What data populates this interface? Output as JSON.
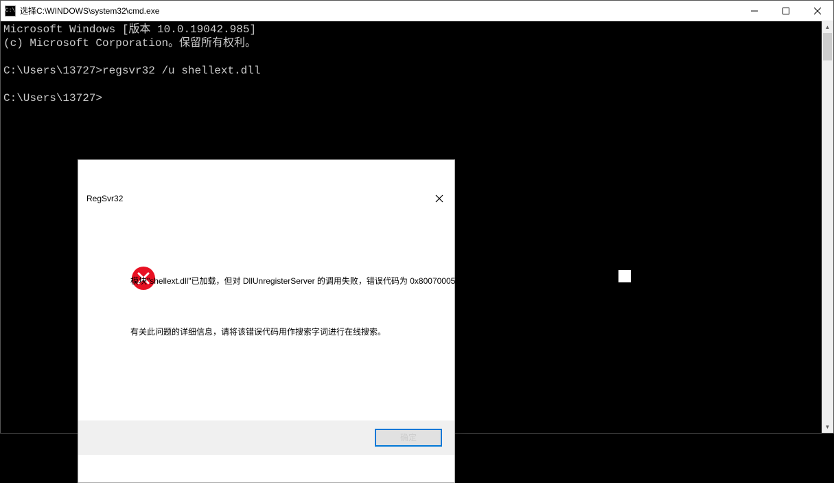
{
  "window": {
    "title": "选择C:\\WINDOWS\\system32\\cmd.exe"
  },
  "console": {
    "line1": "Microsoft Windows [版本 10.0.19042.985]",
    "line2": "(c) Microsoft Corporation。保留所有权利。",
    "line3": "",
    "line4": "C:\\Users\\13727>regsvr32 /u shellext.dll",
    "line5": "",
    "line6": "C:\\Users\\13727>"
  },
  "dialog": {
    "title": "RegSvr32",
    "message1": "模块\"shellext.dll\"已加载，但对 DllUnregisterServer 的调用失败，错误代码为 0x80070005。",
    "message2": "有关此问题的详细信息，请将该错误代码用作搜索字词进行在线搜索。",
    "ok_label": "确定"
  }
}
